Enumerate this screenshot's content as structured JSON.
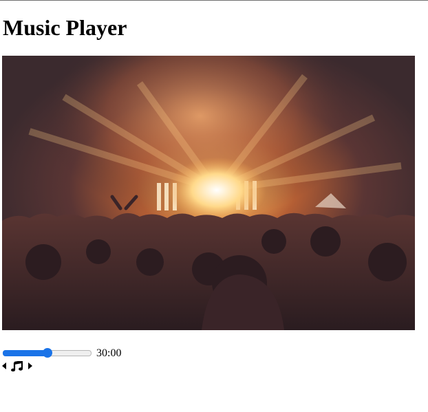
{
  "page": {
    "title": "Music Player"
  },
  "player": {
    "progress": 0.5,
    "time_display": "30:00"
  },
  "controls": {
    "prev_icon": "caret-left-icon",
    "play_icon": "music-note-icon",
    "next_icon": "caret-right-icon"
  },
  "colors": {
    "accent": "#1a73e8"
  }
}
